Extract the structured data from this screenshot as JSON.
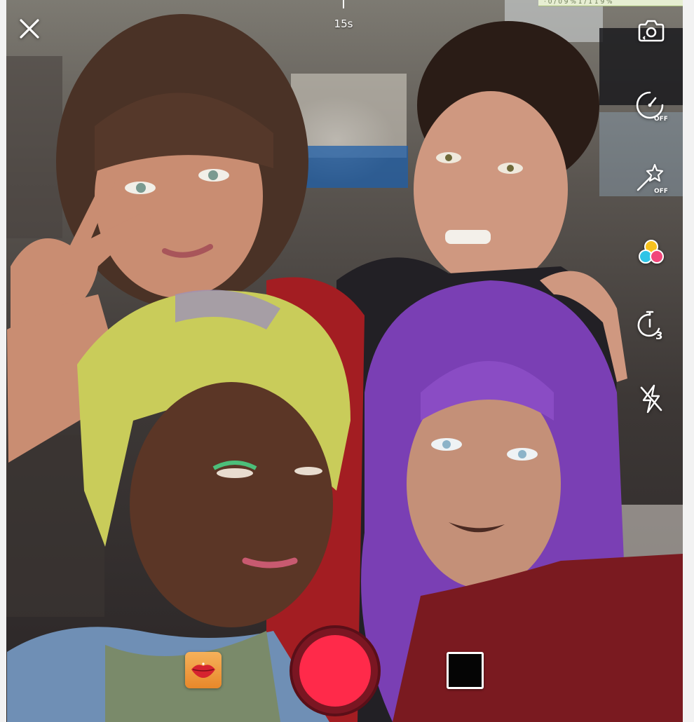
{
  "status_strip": {
    "text": "· 0 / 0 9 %          1 / 1 1 9 %"
  },
  "record": {
    "time_limit_label": "15s"
  },
  "top_controls": {
    "close_icon": "close-icon"
  },
  "side_controls": {
    "flip_icon": "camera-flip-icon",
    "speed_icon": "speed-off-icon",
    "beauty_icon": "beauty-wand-off-icon",
    "filter_icon": "color-filter-icon",
    "countdown_icon": "countdown-3s-icon",
    "flash_icon": "flash-off-icon",
    "off_badge": "OFF",
    "countdown_value": "3"
  },
  "bottom_controls": {
    "effects_icon": "lips-effect-icon",
    "record_icon": "record-button",
    "gallery_icon": "gallery-thumbnail"
  },
  "colors": {
    "record_red": "#ff2a4a",
    "effects_orange": "#f0a040",
    "filter_cyan": "#2ec4e6",
    "filter_yellow": "#f7c21e",
    "filter_pink": "#f1467a"
  }
}
